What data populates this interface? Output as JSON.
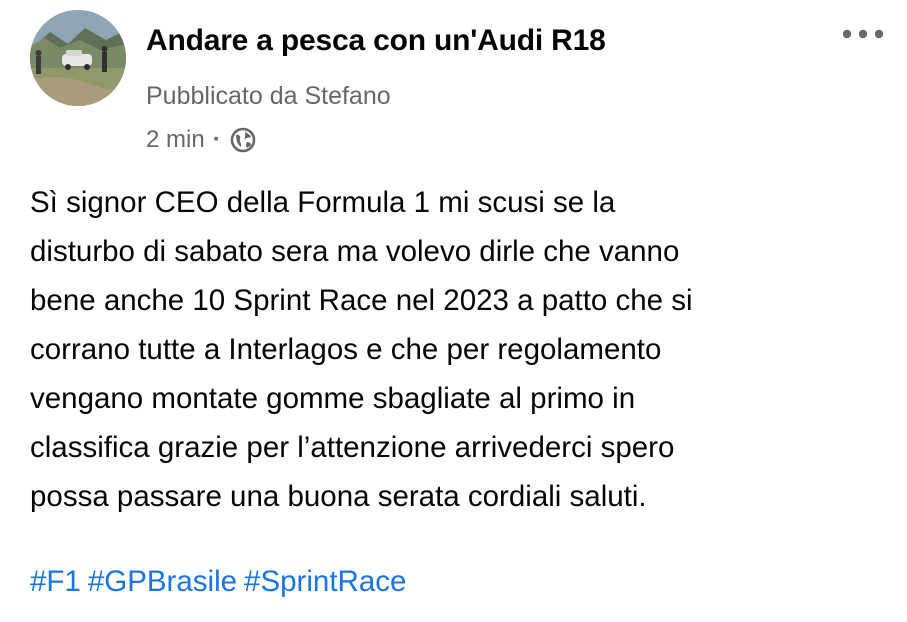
{
  "post": {
    "author": {
      "page_name": "Andare a pesca con un'Audi R18",
      "byline": "Pubblicato da Stefano",
      "avatar_icon": "landscape-photo-avatar"
    },
    "timestamp": "2 min",
    "separator": "·",
    "audience_icon": "globe-icon",
    "more_icon": "more-options-icon",
    "body_lines": [
      "Sì signor CEO della Formula 1 mi scusi se la",
      "disturbo di sabato sera ma volevo dirle che vanno",
      "bene anche 10 Sprint Race nel 2023 a patto che si",
      "corrano tutte a Interlagos e che per regolamento",
      "vengano montate gomme sbagliate al primo in",
      "classifica grazie per l’attenzione arrivederci spero",
      "possa passare una buona serata cordiali saluti."
    ],
    "hashtags": [
      "#F1",
      "#GPBrasile",
      "#SprintRace"
    ]
  },
  "colors": {
    "text_primary": "#050505",
    "text_secondary": "#65676b",
    "hashtag": "#1b74e4",
    "background": "#ffffff"
  }
}
